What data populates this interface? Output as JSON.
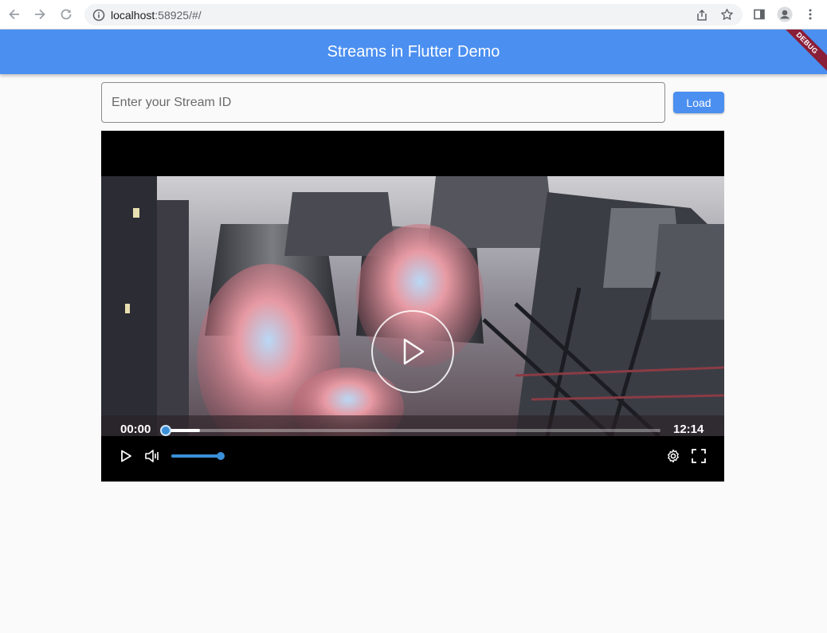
{
  "browser": {
    "url_host": "localhost",
    "url_rest": ":58925/#/"
  },
  "app": {
    "title": "Streams in Flutter Demo",
    "debug_banner": "DEBUG",
    "accent_color": "#4b8ff0"
  },
  "form": {
    "input_placeholder": "Enter your Stream ID",
    "input_value": "",
    "load_label": "Load"
  },
  "player": {
    "current_time": "00:00",
    "duration": "12:14",
    "progress_fraction": 0.0,
    "buffered_fraction": 0.07,
    "volume_fraction": 1.0,
    "accent_color": "#3a8fd8",
    "icons": [
      "play-icon",
      "volume-icon",
      "settings-icon",
      "fullscreen-icon"
    ]
  }
}
